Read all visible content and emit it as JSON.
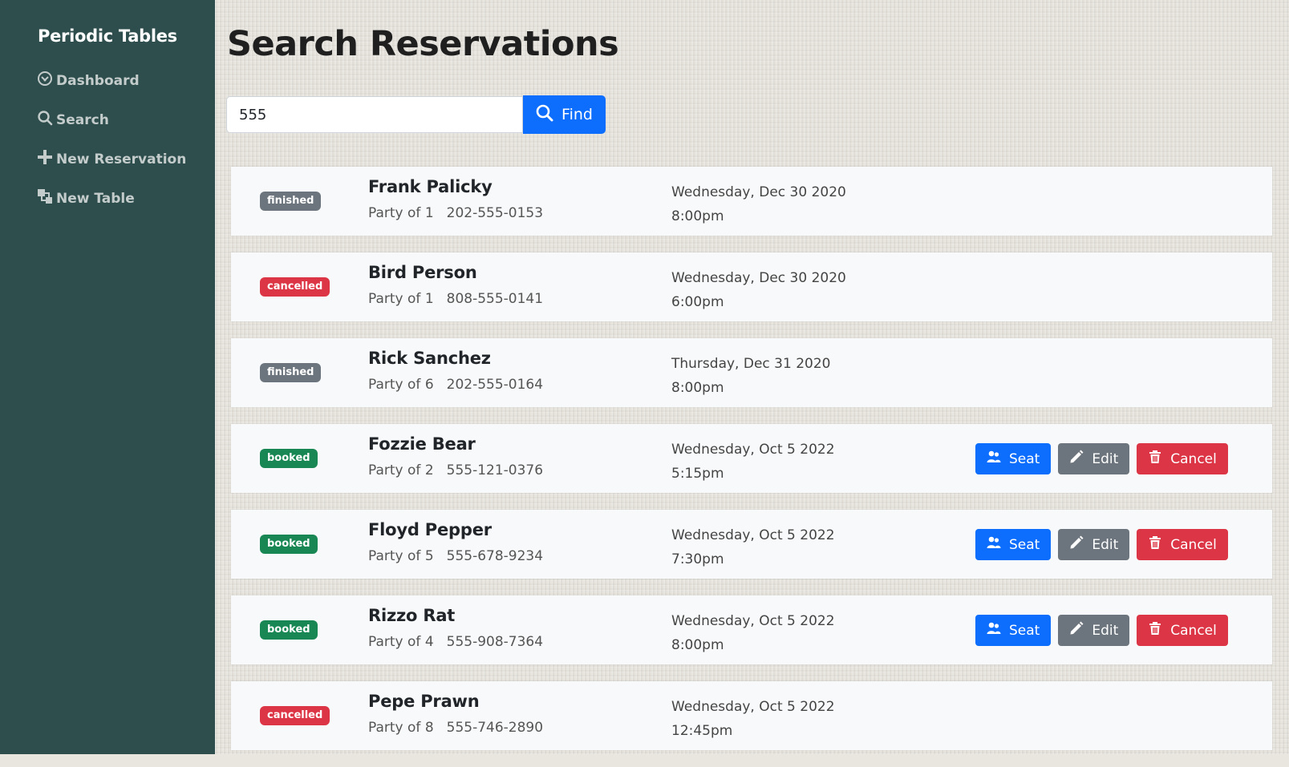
{
  "app": {
    "brand": "Periodic Tables"
  },
  "sidebar": {
    "items": [
      {
        "label": "Dashboard",
        "icon": "dashboard-icon"
      },
      {
        "label": "Search",
        "icon": "search-icon"
      },
      {
        "label": "New Reservation",
        "icon": "plus-icon"
      },
      {
        "label": "New Table",
        "icon": "table-icon"
      }
    ]
  },
  "page": {
    "title": "Search Reservations"
  },
  "search": {
    "value": "555",
    "button_label": "Find"
  },
  "actions": {
    "seat_label": "Seat",
    "edit_label": "Edit",
    "cancel_label": "Cancel"
  },
  "colors": {
    "sidebar": "#2e4e4d",
    "primary": "#0d6efd",
    "secondary": "#6c757d",
    "danger": "#dc3545",
    "success": "#198754"
  },
  "reservations": [
    {
      "status": "finished",
      "name": "Frank Palicky",
      "party": "Party of 1",
      "phone": "202-555-0153",
      "date": "Wednesday, Dec 30 2020",
      "time": "8:00pm"
    },
    {
      "status": "cancelled",
      "name": "Bird Person",
      "party": "Party of 1",
      "phone": "808-555-0141",
      "date": "Wednesday, Dec 30 2020",
      "time": "6:00pm"
    },
    {
      "status": "finished",
      "name": "Rick Sanchez",
      "party": "Party of 6",
      "phone": "202-555-0164",
      "date": "Thursday, Dec 31 2020",
      "time": "8:00pm"
    },
    {
      "status": "booked",
      "name": "Fozzie Bear",
      "party": "Party of 2",
      "phone": "555-121-0376",
      "date": "Wednesday, Oct 5 2022",
      "time": "5:15pm"
    },
    {
      "status": "booked",
      "name": "Floyd Pepper",
      "party": "Party of 5",
      "phone": "555-678-9234",
      "date": "Wednesday, Oct 5 2022",
      "time": "7:30pm"
    },
    {
      "status": "booked",
      "name": "Rizzo Rat",
      "party": "Party of 4",
      "phone": "555-908-7364",
      "date": "Wednesday, Oct 5 2022",
      "time": "8:00pm"
    },
    {
      "status": "cancelled",
      "name": "Pepe Prawn",
      "party": "Party of 8",
      "phone": "555-746-2890",
      "date": "Wednesday, Oct 5 2022",
      "time": "12:45pm"
    }
  ]
}
